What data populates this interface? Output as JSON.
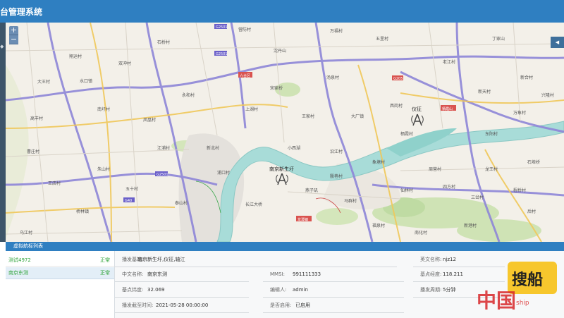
{
  "app": {
    "title": "台管理系统"
  },
  "zoom": {
    "in_label": "+",
    "out_label": "−"
  },
  "map": {
    "labels": {
      "t1": "翔运村",
      "t2": "大王村",
      "t3": "水口镇",
      "t4": "双冲村",
      "t5": "石桥村",
      "t6": "南圩村",
      "t7": "凤凰村",
      "t8": "高丰村",
      "t9": "永和村",
      "t10": "营防村",
      "t11": "万福村",
      "t12": "沈丹山",
      "t13": "宋家桥",
      "t14": "汤泉村",
      "t15": "五里村",
      "t16": "老江村",
      "t17": "丁家山",
      "t18": "新合村",
      "t19": "新天村",
      "t20": "大厂镇",
      "t21": "栖霞村",
      "t22": "万象村",
      "t23": "龙潭镇",
      "t24": "曹庄村",
      "t25": "王店村",
      "t26": "朱山村",
      "t27": "桥林镇",
      "t28": "五十村",
      "t29": "小西湖",
      "t30": "上湖村",
      "t31": "浦口村",
      "t32": "泰山村",
      "t33": "沿江村",
      "t34": "象塘村",
      "t35": "周营村",
      "t36": "长江大桥",
      "t37": "燕子矶",
      "t38": "马群村",
      "t39": "仙林村",
      "t40": "四方村",
      "t41": "龙王村",
      "t42": "石埠桥",
      "t43": "三岔村",
      "t44": "程桥村",
      "t45": "福泉村",
      "t46": "南化村",
      "t47": "新港村",
      "t48": "后村",
      "t49": "六合区",
      "t50": "栖霞山",
      "t51": "王家村",
      "t52": "西岗村",
      "t53": "东阳村",
      "t54": "兴隆村",
      "t55": "殷巷村",
      "t56": "江浦村",
      "t57": "新北村",
      "t58": "乌江村"
    },
    "stations": {
      "s1": "南京新生圩",
      "s2": "仪征"
    },
    "roads": {
      "r1": "G2501",
      "r2": "G205",
      "r3": "S001",
      "r4": "G40"
    }
  },
  "panel": {
    "title": "虚拟航标列表",
    "list": [
      {
        "name": "测试4972",
        "status": "正常"
      },
      {
        "name": "南京东测",
        "status": "正常"
      }
    ]
  },
  "detail": {
    "station_label": "播发基站:",
    "station_value": "南京新生圩,仪征,轴江",
    "en_label": "英文名称:",
    "en_value": "njz12",
    "cn_label": "中文名称:",
    "cn_value": "南京东测",
    "mmsi_label": "MMSI:",
    "mmsi_value": "991111333",
    "lng_label": "基点经度:",
    "lng_value": "118.211",
    "lat_label": "基点纬度:",
    "lat_value": "32.069",
    "editor_label": "编辑人:",
    "editor_value": "admin",
    "period_label": "播发周期:",
    "period_value": "5分钟",
    "until_label": "播发截至时间:",
    "until_value": "2021-05-28 00:00:00",
    "enabled_label": "是否启用:",
    "enabled_value": "已启用"
  },
  "badge": {
    "text": "搜船"
  },
  "watermark": {
    "text": "中国",
    "sub": "ship"
  }
}
